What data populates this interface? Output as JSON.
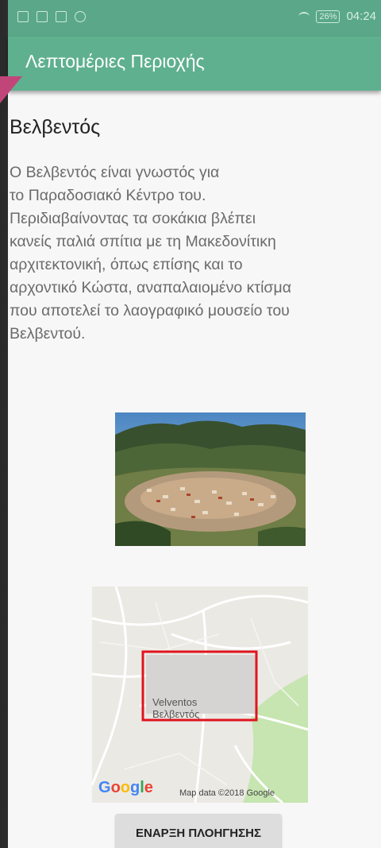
{
  "status_bar": {
    "battery": "26%",
    "time": "04:24"
  },
  "app_bar": {
    "title": "Λεπτομέριες Περιοχής"
  },
  "place": {
    "name": "Βελβεντός",
    "description": "Ο Βελβεντός είναι γνωστός για\nτο Παραδοσιακό Κέντρο του.\nΠεριδιαβαίνοντας τα σοκάκια βλέπει\nκανείς παλιά σπίτια με τη Μακεδονίτικη\nαρχιτεκτονική, όπως επίσης και το\nαρχοντικό Κώστα, αναπαλαιομένο κτίσμα\nπου αποτελεί το λαογραφικό μουσείο του\nΒελβεντού."
  },
  "map": {
    "label_latin": "Velventos",
    "label_greek": "Βελβεντός",
    "attribution": "Map data ©2018 Google",
    "google_logo": [
      "G",
      "o",
      "o",
      "g",
      "l",
      "e"
    ]
  },
  "actions": {
    "start_navigation": "ΕΝΑΡΞΗ ΠΛΟΗΓΗΣΗΣ"
  },
  "colors": {
    "accent": "#5fb08f",
    "marker": "#e0141e"
  }
}
